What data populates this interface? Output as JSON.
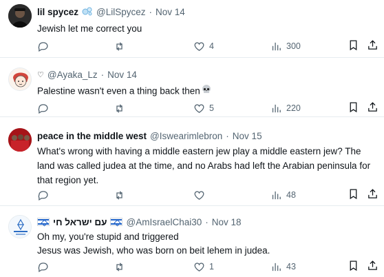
{
  "replies": [
    {
      "name": "lil spycez",
      "handle": "@LilSpycez",
      "dot": "·",
      "date": "Nov 14",
      "text": "Jewish let me correct you",
      "likes": "4",
      "views": "300",
      "name_icon": "bubbles-emoji-icon"
    },
    {
      "prefix": "♡",
      "handle": "@Ayaka_Lz",
      "dot": "·",
      "date": "Nov 14",
      "text": "Palestine wasn't even a thing back then",
      "text_emoji": "skull-emoji-icon",
      "likes": "5",
      "views": "220"
    },
    {
      "name": "peace in the middle west",
      "handle": "@Iswearimlebron",
      "dot": "·",
      "date": "Nov 15",
      "text": "What's wrong with having a middle eastern jew play a middle eastern jew?  The land was called judea at the time, and no Arabs had left the Arabian peninsula for that region yet.",
      "likes": "",
      "views": "48"
    },
    {
      "name": "עם ישראל חי",
      "handle": "@AmIsraelChai30",
      "dot": "·",
      "date": "Nov 18",
      "text_line1": "Oh my, you're stupid and triggered",
      "text_line2": "Jesus was Jewish, who was born on beit lehem in judea.",
      "likes": "1",
      "views": "43",
      "name_icons": [
        "israel-flag-icon",
        "israel-flag-icon"
      ]
    }
  ],
  "colors": {
    "text": "#0f1419",
    "muted": "#536471",
    "divider": "#e6ecf0"
  }
}
